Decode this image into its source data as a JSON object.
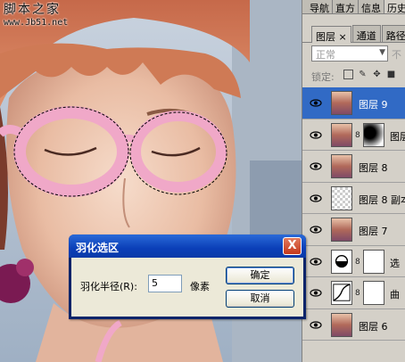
{
  "watermark": {
    "site_name": "脚本之家",
    "url": "www.Jb51.net"
  },
  "dialog": {
    "title": "羽化选区",
    "close_glyph": "X",
    "field_label": "羽化半径(R):",
    "field_value": "5",
    "unit": "像素",
    "ok_label": "确定",
    "cancel_label": "取消"
  },
  "panel": {
    "top_tabs": [
      "导航",
      "直方",
      "信息",
      "历史"
    ],
    "layer_tabs": [
      "图层 ×",
      "通道",
      "路径"
    ],
    "blend_mode": "正常",
    "opacity_hint": "不",
    "lock_label": "锁定:",
    "layers": [
      {
        "name": "图层 9",
        "selected": true,
        "thumb": "photo",
        "mask": ""
      },
      {
        "name": "图层",
        "selected": false,
        "thumb": "photo",
        "mask": "gradient"
      },
      {
        "name": "图层 8",
        "selected": false,
        "thumb": "photo",
        "mask": ""
      },
      {
        "name": "图层 8 副本",
        "selected": false,
        "thumb": "transparent",
        "mask": ""
      },
      {
        "name": "图层 7",
        "selected": false,
        "thumb": "photo",
        "mask": ""
      },
      {
        "name": "选",
        "selected": false,
        "thumb": "adjustment",
        "mask": "white"
      },
      {
        "name": "曲",
        "selected": false,
        "thumb": "curves",
        "mask": "white"
      },
      {
        "name": "图层 6",
        "selected": false,
        "thumb": "photo",
        "mask": ""
      }
    ]
  },
  "colors": {
    "titlebar": "#0b3fb8",
    "selected_layer": "#316ac5",
    "glasses_pink": "#f0a8c8"
  }
}
